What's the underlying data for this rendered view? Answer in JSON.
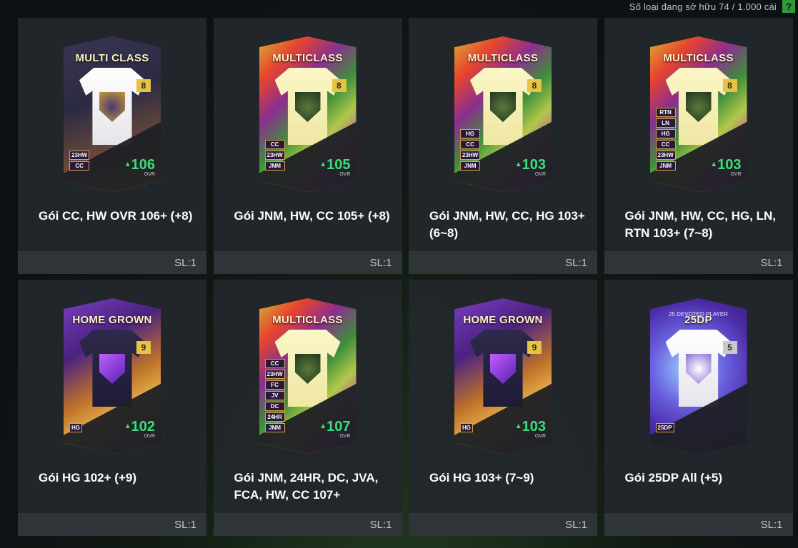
{
  "header": {
    "owned_text": "Số loại đang sở hữu  74 / 1.000 cái",
    "help": "?"
  },
  "packs": [
    {
      "title": "Gói CC, HW OVR 106+ (+8)",
      "qty": "SL:1",
      "label": "MULTI CLASS",
      "level": "8",
      "ovr": "106",
      "ovr_label": "OVR",
      "tags": [
        "23HW",
        "CC"
      ],
      "style": "mc1"
    },
    {
      "title": "Gói JNM, HW, CC 105+ (+8)",
      "qty": "SL:1",
      "label": "MULTICLASS",
      "level": "8",
      "ovr": "105",
      "ovr_label": "OVR",
      "tags": [
        "CC",
        "23HW",
        "JNM"
      ],
      "style": "mc"
    },
    {
      "title": "Gói JNM, HW, CC, HG 103+ (6~8)",
      "qty": "SL:1",
      "label": "MULTICLASS",
      "level": "8",
      "ovr": "103",
      "ovr_label": "OVR",
      "tags": [
        "HG",
        "CC",
        "23HW",
        "JNM"
      ],
      "style": "mc"
    },
    {
      "title": "Gói JNM, HW, CC, HG, LN, RTN 103+ (7~8)",
      "qty": "SL:1",
      "label": "MULTICLASS",
      "level": "8",
      "ovr": "103",
      "ovr_label": "OVR",
      "tags": [
        "RTN",
        "LN",
        "HG",
        "CC",
        "23HW",
        "JNM"
      ],
      "style": "mc"
    },
    {
      "title": "Gói HG 102+ (+9)",
      "qty": "SL:1",
      "label": "HOME GROWN",
      "level": "9",
      "ovr": "102",
      "ovr_label": "OVR",
      "tags": [
        "HG"
      ],
      "style": "hg"
    },
    {
      "title": "Gói JNM, 24HR, DC, JVA, FCA, HW, CC 107+",
      "qty": "SL:1",
      "label": "MULTICLASS",
      "level": "",
      "ovr": "107",
      "ovr_label": "OVR",
      "tags": [
        "CC",
        "23HW",
        "FC",
        "JV",
        "DC",
        "24HR",
        "JNM"
      ],
      "style": "mc"
    },
    {
      "title": "Gói HG 103+ (7~9)",
      "qty": "SL:1",
      "label": "HOME GROWN",
      "level": "9",
      "ovr": "103",
      "ovr_label": "OVR",
      "tags": [
        "HG"
      ],
      "style": "hg"
    },
    {
      "title": "Gói 25DP All (+5)",
      "qty": "SL:1",
      "label": "25DP",
      "sublabel": "25 DEVOTED PLAYER",
      "level": "5",
      "ovr": "",
      "ovr_label": "",
      "tags": [
        "25DP"
      ],
      "style": "dp"
    }
  ],
  "colors": {
    "ovr_green": "#37e07a",
    "help_green": "#2f9a3a",
    "tile_bg": "#23272c"
  }
}
